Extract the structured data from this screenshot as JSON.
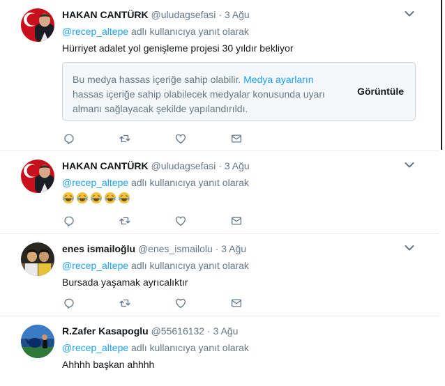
{
  "tweets": [
    {
      "name": "HAKAN CANTÜRK",
      "handle": "@uludagsefasi",
      "separator": "·",
      "date": "3 Ağu",
      "reply_to": "@recep_altepe",
      "reply_suffix": " adlı kullanıcıya yanıt olarak",
      "text": "Hürriyet adalet yol genişleme projesi 30 yıldır bekliyor",
      "sensitive": {
        "text_before": "Bu medya hassas içeriğe sahip olabilir. ",
        "link": "Medya ayarların",
        "text_after": " hassas içeriğe sahip olabilecek medyalar konusunda uyarı almanı sağlayacak şekilde yapılandırıldı.",
        "button": "Görüntüle"
      }
    },
    {
      "name": "HAKAN CANTÜRK",
      "handle": "@uludagsefasi",
      "separator": "·",
      "date": "3 Ağu",
      "reply_to": "@recep_altepe",
      "reply_suffix": " adlı kullanıcıya yanıt olarak",
      "text": "😂😂😂😂😂"
    },
    {
      "name": "enes ismailoğlu",
      "handle": "@enes_ismailolu",
      "separator": "·",
      "date": "3 Ağu",
      "reply_to": "@recep_altepe",
      "reply_suffix": " adlı kullanıcıya yanıt olarak",
      "text": "Bursada yaşamak ayrıcalıktır"
    },
    {
      "name": "R.Zafer Kasapoglu",
      "handle": "@55616132",
      "separator": "·",
      "date": "3 Ağu",
      "reply_to": "@recep_altepe",
      "reply_suffix": " adlı kullanıcıya yanıt olarak",
      "text": "Ahhhh başkan ahhhh"
    }
  ],
  "icons": [
    "reply-icon",
    "retweet-icon",
    "like-icon",
    "dm-icon",
    "chevron-down-icon",
    "laughing-crying-emoji"
  ],
  "colors": {
    "link": "#1da1f2",
    "secondary_text": "#657786",
    "divider": "#e6ecf0",
    "emoji": "#f5c33b"
  }
}
